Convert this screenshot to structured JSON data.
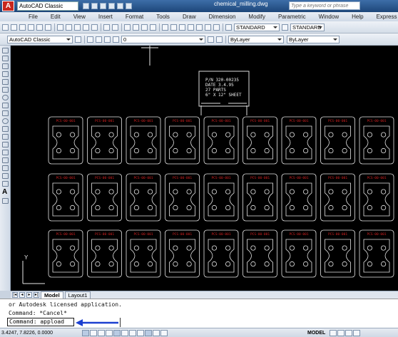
{
  "titlebar": {
    "app_icon": "A",
    "workspace": "AutoCAD Classic",
    "document": "chemical_milling.dwg",
    "help_placeholder": "Type a keyword or phrase"
  },
  "menubar": [
    "File",
    "Edit",
    "View",
    "Insert",
    "Format",
    "Tools",
    "Draw",
    "Dimension",
    "Modify",
    "Parametric",
    "Window",
    "Help",
    "Express"
  ],
  "toolbar1": {
    "text_style": "STANDARD",
    "dim_style": "STANDARD"
  },
  "toolbar2": {
    "workspace": "AutoCAD Classic",
    "layer": "0",
    "color": "ByLayer",
    "linetype": "ByLayer"
  },
  "drawing": {
    "title_block": [
      "P/N 320-00235",
      "DATE 3.4.95",
      "27 PARTS",
      "6\" X 12\" SHEET"
    ],
    "part_label": "PCS-00-001",
    "grid_rows": 3,
    "grid_cols": 9,
    "ucs_label": "Y"
  },
  "tabs": {
    "nav": [
      "|◂",
      "◂",
      "▸",
      "▸|"
    ],
    "items": [
      "Model",
      "Layout1"
    ]
  },
  "command": {
    "history": [
      "or Autodesk licensed application.",
      "Command: *Cancel*"
    ],
    "current": "Command: appload"
  },
  "statusbar": {
    "coords": "3.4247, 7.8226, 0.0000",
    "model": "MODEL"
  },
  "colors": {
    "accent": "#1e5ba8",
    "part_label": "#d02020",
    "arrow": "#1b3fd0"
  }
}
